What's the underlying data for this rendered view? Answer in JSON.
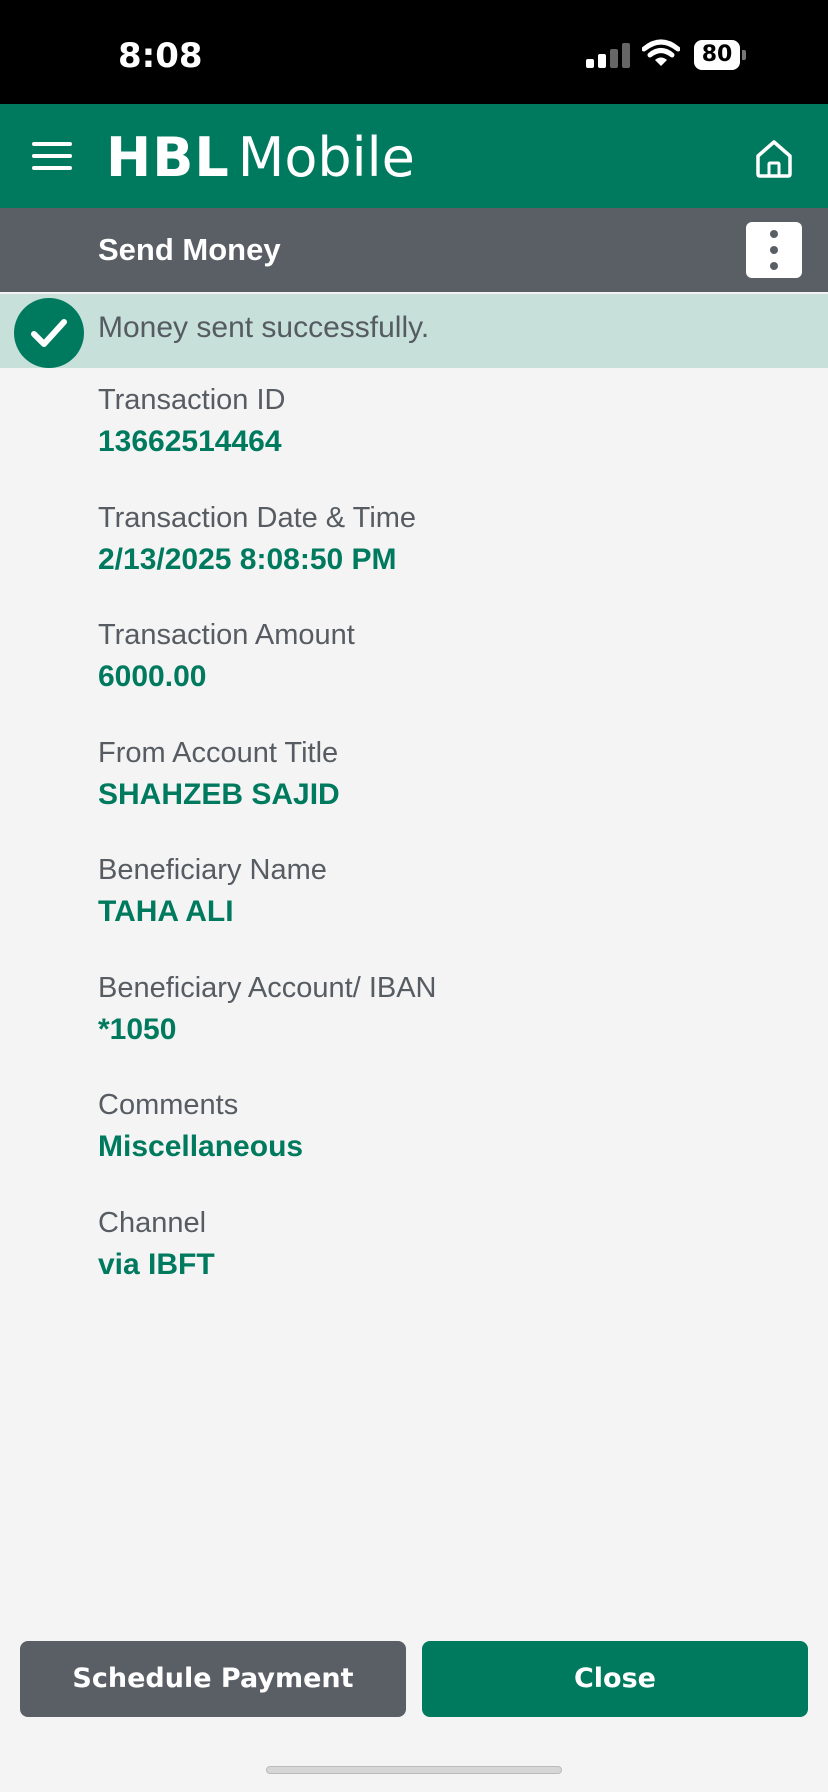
{
  "status_bar": {
    "time": "8:08",
    "battery": "80",
    "icons": [
      "cellular-signal-icon",
      "wifi-icon",
      "battery-icon"
    ]
  },
  "header": {
    "brand_mark": "HBL",
    "brand_word": "Mobile",
    "menu_icon": "hamburger-menu-icon",
    "home_icon": "home-icon",
    "color": "#007a5e"
  },
  "subheader": {
    "title": "Send Money",
    "more_icon": "more-vertical-icon",
    "color": "#5a5f66"
  },
  "banner": {
    "message": "Money sent successfully.",
    "icon": "check-circle-icon",
    "background": "#c7e0da"
  },
  "details": [
    {
      "label": "Transaction ID",
      "value": "13662514464"
    },
    {
      "label": "Transaction Date & Time",
      "value": "2/13/2025 8:08:50 PM"
    },
    {
      "label": "Transaction Amount",
      "value": "6000.00"
    },
    {
      "label": "From Account Title",
      "value": "SHAHZEB SAJID"
    },
    {
      "label": "Beneficiary Name",
      "value": "TAHA ALI"
    },
    {
      "label": "Beneficiary Account/ IBAN",
      "value": "*1050"
    },
    {
      "label": "Comments",
      "value": "Miscellaneous"
    },
    {
      "label": "Channel",
      "value": "via IBFT"
    }
  ],
  "actions": {
    "schedule_label": "Schedule Payment",
    "close_label": "Close"
  }
}
